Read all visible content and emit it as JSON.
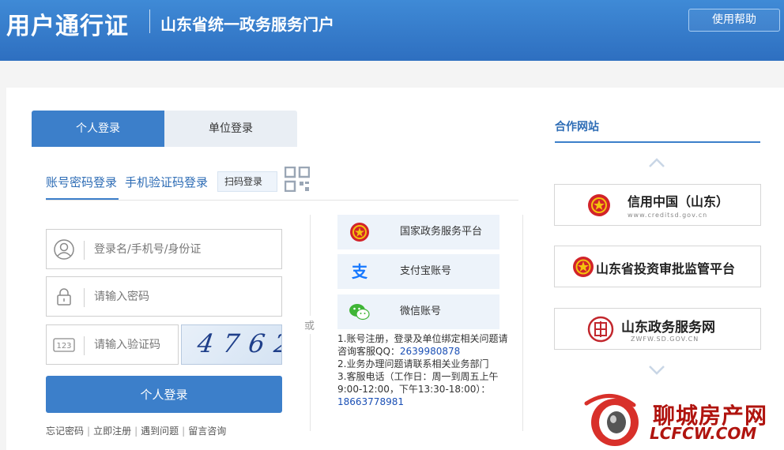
{
  "header": {
    "title": "用户通行证",
    "subtitle": "山东省统一政务服务门户",
    "help_label": "使用帮助"
  },
  "tabs": {
    "personal": "个人登录",
    "organization": "单位登录"
  },
  "sub_tabs": {
    "account": "账号密码登录",
    "sms": "手机验证码登录",
    "qr": "扫码登录"
  },
  "form": {
    "username_placeholder": "登录名/手机号/身份证",
    "password_placeholder": "请输入密码",
    "captcha_placeholder": "请输入验证码",
    "captcha_code": "4762",
    "login_button": "个人登录"
  },
  "links": [
    "忘记密码",
    "立即注册",
    "遇到问题",
    "留言咨询"
  ],
  "or_label": "或",
  "third_party": [
    {
      "label": "国家政务服务平台",
      "icon": "national-emblem-icon"
    },
    {
      "label": "支付宝账号",
      "icon": "alipay-icon"
    },
    {
      "label": "微信账号",
      "icon": "wechat-icon"
    }
  ],
  "notes": {
    "line1": "1.账号注册，登录及单位绑定相关问题请咨询客服QQ：",
    "qq": "2639980878",
    "line2": "2.业务办理问题请联系相关业务部门",
    "line3": "3.客服电话（工作日：周一到周五上午9:00-12:00，下午13:30-18:00）：",
    "phone": "18663778981"
  },
  "partners": {
    "title": "合作网站",
    "items": [
      {
        "label": "信用中国（山东）",
        "sub": "www.creditsd.gov.cn",
        "icon": "national-emblem-icon"
      },
      {
        "label": "山东省投资审批监管平台",
        "sub": "",
        "icon": "national-emblem-icon"
      },
      {
        "label": "山东政务服务网",
        "sub": "ZWFW.SD.GOV.CN",
        "icon": "seal-icon"
      }
    ]
  },
  "watermark": {
    "cn": "聊城房产网",
    "en": "LCFCW.COM"
  },
  "colors": {
    "header": "#2e6fc0",
    "accent": "#3c7fca",
    "link": "#1a4fb5",
    "watermark": "#b0140f"
  }
}
